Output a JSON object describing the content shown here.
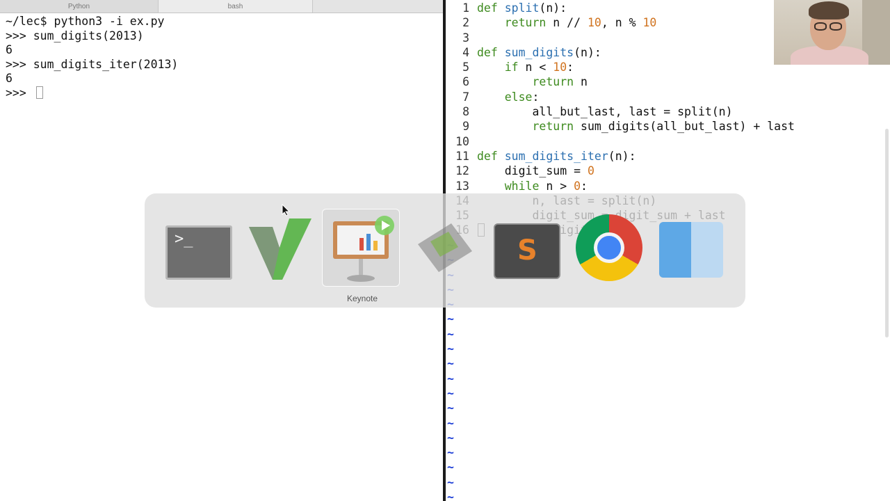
{
  "terminal": {
    "tabs": [
      "Python",
      "bash",
      ""
    ],
    "lines": [
      "~/lec$ python3 -i ex.py",
      ">>> sum_digits(2013)",
      "6",
      ">>> sum_digits_iter(2013)",
      "6",
      ">>> "
    ]
  },
  "editor": {
    "lines": [
      {
        "n": "1",
        "segs": [
          [
            "kw",
            "def"
          ],
          [
            "t",
            " "
          ],
          [
            "fn",
            "split"
          ],
          [
            "t",
            "(n):"
          ]
        ]
      },
      {
        "n": "2",
        "segs": [
          [
            "t",
            "    "
          ],
          [
            "kw",
            "return"
          ],
          [
            "t",
            " n // "
          ],
          [
            "num",
            "10"
          ],
          [
            "t",
            ", n % "
          ],
          [
            "num",
            "10"
          ]
        ]
      },
      {
        "n": "3",
        "segs": []
      },
      {
        "n": "4",
        "segs": [
          [
            "kw",
            "def"
          ],
          [
            "t",
            " "
          ],
          [
            "fn",
            "sum_digits"
          ],
          [
            "t",
            "(n):"
          ]
        ]
      },
      {
        "n": "5",
        "segs": [
          [
            "t",
            "    "
          ],
          [
            "kw",
            "if"
          ],
          [
            "t",
            " n < "
          ],
          [
            "num",
            "10"
          ],
          [
            "t",
            ":"
          ]
        ]
      },
      {
        "n": "6",
        "segs": [
          [
            "t",
            "        "
          ],
          [
            "kw",
            "return"
          ],
          [
            "t",
            " n"
          ]
        ]
      },
      {
        "n": "7",
        "segs": [
          [
            "t",
            "    "
          ],
          [
            "kw",
            "else"
          ],
          [
            "t",
            ":"
          ]
        ]
      },
      {
        "n": "8",
        "segs": [
          [
            "t",
            "        all_but_last, last = split(n)"
          ]
        ]
      },
      {
        "n": "9",
        "segs": [
          [
            "t",
            "        "
          ],
          [
            "kw",
            "return"
          ],
          [
            "t",
            " sum_digits(all_but_last) + last"
          ]
        ]
      },
      {
        "n": "10",
        "segs": []
      },
      {
        "n": "11",
        "segs": [
          [
            "kw",
            "def"
          ],
          [
            "t",
            " "
          ],
          [
            "fn",
            "sum_digits_iter"
          ],
          [
            "t",
            "(n):"
          ]
        ]
      },
      {
        "n": "12",
        "segs": [
          [
            "t",
            "    digit_sum = "
          ],
          [
            "num",
            "0"
          ]
        ]
      },
      {
        "n": "13",
        "segs": [
          [
            "t",
            "    "
          ],
          [
            "kw",
            "while"
          ],
          [
            "t",
            " n > "
          ],
          [
            "num",
            "0"
          ],
          [
            "t",
            ":"
          ]
        ]
      },
      {
        "n": "14",
        "segs": [
          [
            "t",
            "        n, last = split(n)"
          ]
        ]
      },
      {
        "n": "15",
        "segs": [
          [
            "t",
            "        digit_sum = digit_sum + last"
          ]
        ]
      },
      {
        "n": "16",
        "segs": [
          [
            "t",
            "    "
          ],
          [
            "kw",
            "return"
          ],
          [
            "t",
            " digit_sum"
          ]
        ]
      }
    ],
    "tilde_char": "~",
    "tilde_count": 18
  },
  "app_switcher": {
    "apps": [
      {
        "name": "Terminal",
        "icon": "terminal-icon",
        "glyph": ">_"
      },
      {
        "name": "MacVim",
        "icon": "vim-icon"
      },
      {
        "name": "Keynote",
        "icon": "keynote-icon",
        "selected": true
      },
      {
        "name": "Screen recorder",
        "icon": "film-icon"
      },
      {
        "name": "Sublime Text",
        "icon": "sublime-icon",
        "glyph": "S"
      },
      {
        "name": "Google Chrome",
        "icon": "chrome-icon"
      },
      {
        "name": "Finder",
        "icon": "finder-icon"
      }
    ],
    "selected_label": "Keynote"
  },
  "colors": {
    "keyword": "#3d8a1e",
    "function": "#2b6fb0",
    "number": "#d0731f",
    "tilde": "#1e3fd6"
  }
}
